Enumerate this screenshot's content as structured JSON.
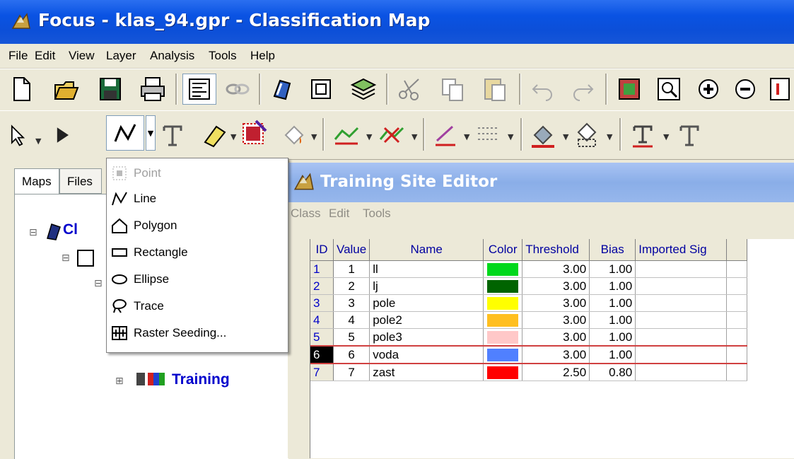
{
  "window": {
    "title": "Focus - klas_94.gpr - Classification Map"
  },
  "menubar": {
    "items": [
      "File",
      "Edit",
      "View",
      "Layer",
      "Analysis",
      "Tools",
      "Help"
    ]
  },
  "left_panel": {
    "tabs": [
      "Maps",
      "Files"
    ],
    "tree": {
      "root_label": "Cl",
      "child_label": "Training"
    }
  },
  "dropdown": {
    "items": [
      {
        "label": "Point",
        "icon": "point-icon",
        "enabled": false
      },
      {
        "label": "Line",
        "icon": "line-icon",
        "enabled": true
      },
      {
        "label": "Polygon",
        "icon": "polygon-icon",
        "enabled": true
      },
      {
        "label": "Rectangle",
        "icon": "rectangle-icon",
        "enabled": true
      },
      {
        "label": "Ellipse",
        "icon": "ellipse-icon",
        "enabled": true
      },
      {
        "label": "Trace",
        "icon": "trace-icon",
        "enabled": true
      },
      {
        "label": "Raster Seeding...",
        "icon": "raster-seeding-icon",
        "enabled": true
      }
    ]
  },
  "editor": {
    "title": "Training Site Editor",
    "menu": [
      "Class",
      "Edit",
      "Tools"
    ],
    "columns": [
      "ID",
      "Value",
      "Name",
      "Color",
      "Threshold",
      "Bias",
      "Imported Sig"
    ],
    "rows": [
      {
        "id": "1",
        "value": "1",
        "name": "ll",
        "color": "#00d81c",
        "threshold": "3.00",
        "bias": "1.00",
        "imported": ""
      },
      {
        "id": "2",
        "value": "2",
        "name": "lj",
        "color": "#006400",
        "threshold": "3.00",
        "bias": "1.00",
        "imported": ""
      },
      {
        "id": "3",
        "value": "3",
        "name": "pole",
        "color": "#ffff00",
        "threshold": "3.00",
        "bias": "1.00",
        "imported": ""
      },
      {
        "id": "4",
        "value": "4",
        "name": "pole2",
        "color": "#ffbf1f",
        "threshold": "3.00",
        "bias": "1.00",
        "imported": ""
      },
      {
        "id": "5",
        "value": "5",
        "name": "pole3",
        "color": "#ffc8c8",
        "threshold": "3.00",
        "bias": "1.00",
        "imported": ""
      },
      {
        "id": "6",
        "value": "6",
        "name": "voda",
        "color": "#5080ff",
        "threshold": "3.00",
        "bias": "1.00",
        "imported": ""
      },
      {
        "id": "7",
        "value": "7",
        "name": "zast",
        "color": "#ff0000",
        "threshold": "2.50",
        "bias": "0.80",
        "imported": ""
      }
    ],
    "selected_row_id": "6"
  },
  "colors": {
    "titlebar": "#0a53e3",
    "selection_border": "#d04040"
  }
}
